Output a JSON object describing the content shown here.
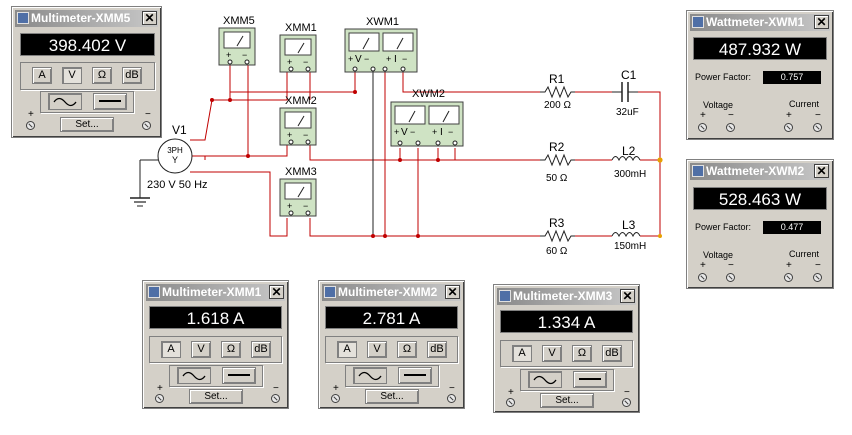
{
  "circuit": {
    "source_name": "V1",
    "source_symbol": "3PH",
    "source_y": "Y",
    "source_rating": "230 V 50 Hz",
    "instruments": {
      "xmm5": "XMM5",
      "xmm1": "XMM1",
      "xmm2": "XMM2",
      "xmm3": "XMM3",
      "xwm1": "XWM1",
      "xwm2": "XWM2"
    },
    "wattmeter_labels": {
      "v": "V",
      "i": "I"
    },
    "components": {
      "r1": {
        "name": "R1",
        "value": "200 Ω"
      },
      "c1": {
        "name": "C1",
        "value": "32uF"
      },
      "r2": {
        "name": "R2",
        "value": "50 Ω"
      },
      "l2": {
        "name": "L2",
        "value": "300mH"
      },
      "r3": {
        "name": "R3",
        "value": "60 Ω"
      },
      "l3": {
        "name": "L3",
        "value": "150mH"
      }
    }
  },
  "windows": {
    "mm5": {
      "title": "Multimeter-XMM5",
      "reading": "398.402 V",
      "active_mode": "V"
    },
    "mm1": {
      "title": "Multimeter-XMM1",
      "reading": "1.618 A",
      "active_mode": "A"
    },
    "mm2": {
      "title": "Multimeter-XMM2",
      "reading": "2.781 A",
      "active_mode": "A"
    },
    "mm3": {
      "title": "Multimeter-XMM3",
      "reading": "1.334 A",
      "active_mode": "A"
    },
    "wm1": {
      "title": "Wattmeter-XWM1",
      "reading": "487.932 W",
      "power_factor": "0.757"
    },
    "wm2": {
      "title": "Wattmeter-XWM2",
      "reading": "528.463 W",
      "power_factor": "0.477"
    }
  },
  "multimeter_ui": {
    "mode_a": "A",
    "mode_v": "V",
    "mode_ohm": "Ω",
    "mode_db": "dB",
    "set_label": "Set...",
    "plus": "+",
    "minus": "−"
  },
  "wattmeter_ui": {
    "pf_label": "Power Factor:",
    "voltage_label": "Voltage",
    "current_label": "Current",
    "plus": "+",
    "minus": "−"
  },
  "colors": {
    "wire_red": "#c00000",
    "wire_black": "#202020",
    "node_orange": "#e8a000",
    "instrument_green": "#cfe3c4"
  }
}
